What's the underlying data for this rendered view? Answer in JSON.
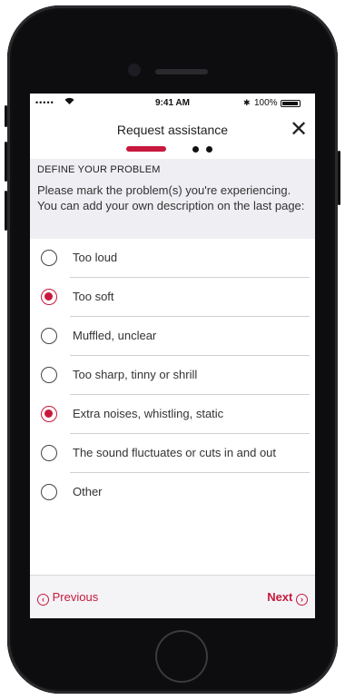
{
  "status_bar": {
    "signal": "•••••",
    "time": "9:41 AM",
    "battery_pct": "100%"
  },
  "header": {
    "title": "Request assistance",
    "close_icon": "close-icon",
    "steps_total": 3,
    "current_step": 1
  },
  "info": {
    "heading": "DEFINE YOUR PROBLEM",
    "description": "Please mark the problem(s) you're experiencing. You can add your own description on the last page:"
  },
  "options": [
    {
      "label": "Too loud",
      "selected": false
    },
    {
      "label": "Too soft",
      "selected": true
    },
    {
      "label": "Muffled, unclear",
      "selected": false
    },
    {
      "label": "Too sharp, tinny or shrill",
      "selected": false
    },
    {
      "label": "Extra noises, whistling, static",
      "selected": true
    },
    {
      "label": "The sound fluctuates or cuts in and out",
      "selected": false
    },
    {
      "label": "Other",
      "selected": false
    }
  ],
  "footer": {
    "previous_label": "Previous",
    "next_label": "Next"
  },
  "colors": {
    "accent": "#c8193c",
    "panel": "#efeff3"
  }
}
